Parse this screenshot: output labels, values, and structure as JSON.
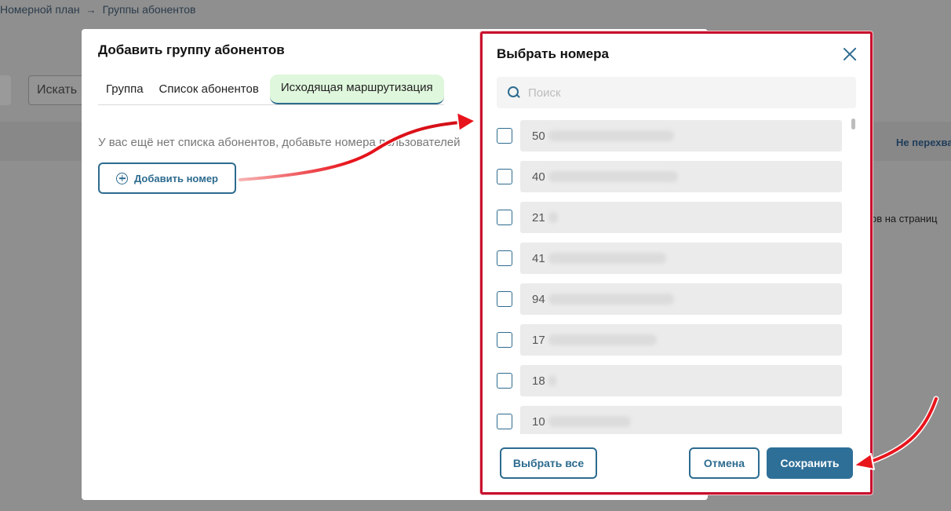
{
  "background": {
    "breadcrumb": [
      "Номерной план",
      "Группы абонентов"
    ],
    "breadcrumb_separator": "→",
    "search_placeholder": "Искать",
    "column_header": "Не перехва",
    "pagination_hint": "ов на страниц"
  },
  "group_modal": {
    "title": "Добавить группу абонентов",
    "tabs": [
      {
        "label": "Группа",
        "active": false
      },
      {
        "label": "Список абонентов",
        "active": false
      },
      {
        "label": "Исходящая маршрутизация",
        "active": true
      }
    ],
    "empty_message": "У вас ещё нет списка абонентов, добавьте номера пользователей",
    "add_number_button": "Добавить номер"
  },
  "select_modal": {
    "title": "Выбрать номера",
    "search_placeholder": "Поиск",
    "numbers": [
      {
        "visible_prefix": "50",
        "checked": false
      },
      {
        "visible_prefix": "40",
        "checked": false
      },
      {
        "visible_prefix": "21",
        "checked": false
      },
      {
        "visible_prefix": "41",
        "checked": false
      },
      {
        "visible_prefix": "94",
        "checked": false
      },
      {
        "visible_prefix": "17",
        "checked": false
      },
      {
        "visible_prefix": "18",
        "checked": false
      },
      {
        "visible_prefix": "10",
        "checked": false
      }
    ],
    "select_all_button": "Выбрать все",
    "cancel_button": "Отмена",
    "save_button": "Сохранить"
  },
  "colors": {
    "accent": "#2d6b8f",
    "save_button": "#2e6f98",
    "active_tab_bg": "#dff7dc",
    "highlight_border": "#c8102e",
    "annotation_arrow": "#e8141c"
  }
}
